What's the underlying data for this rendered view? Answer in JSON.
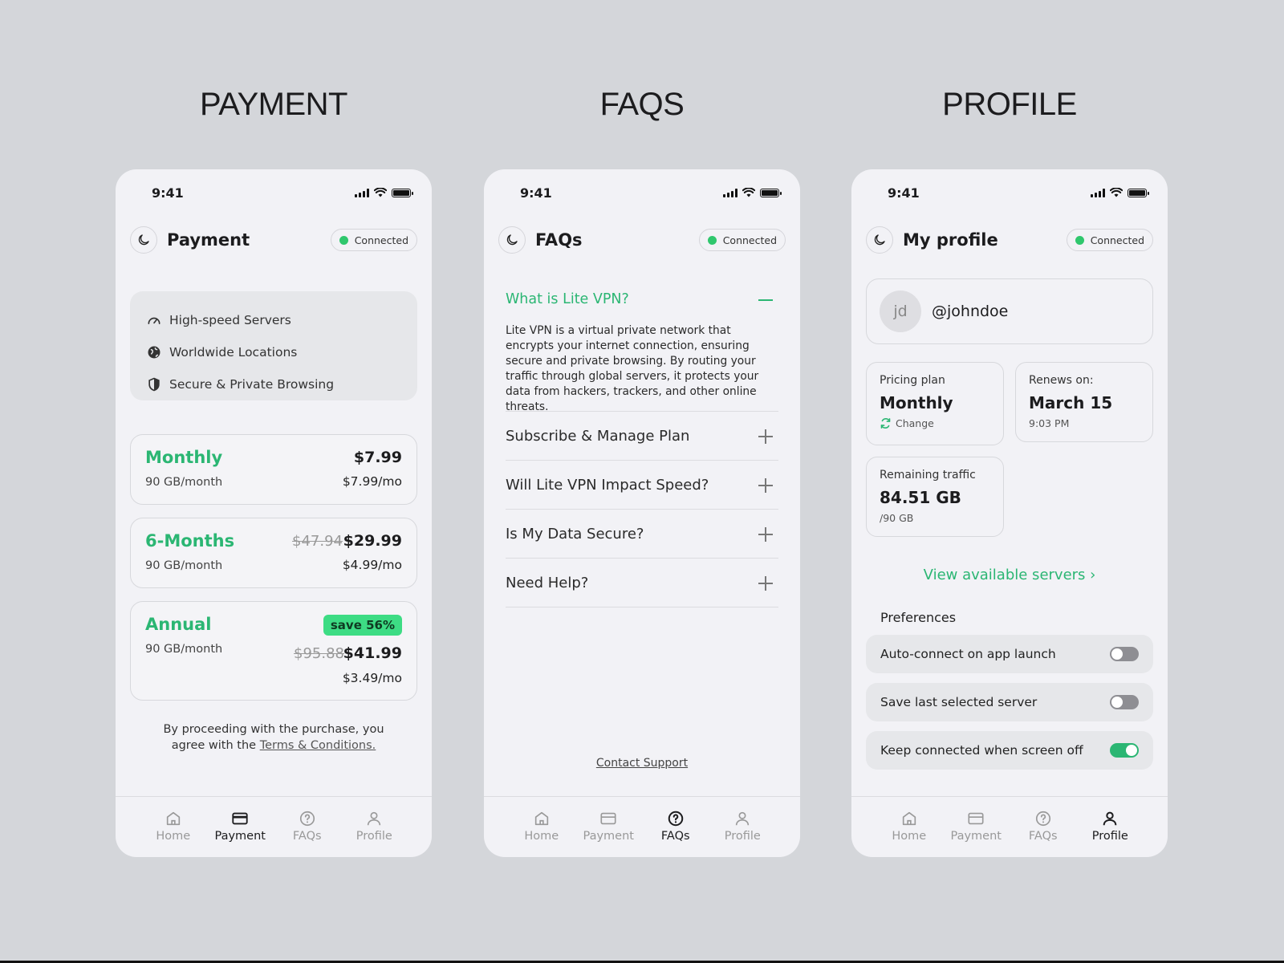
{
  "headings": {
    "payment": "PAYMENT",
    "faqs": "FAQS",
    "profile": "PROFILE"
  },
  "status": {
    "time": "9:41"
  },
  "connection_label": "Connected",
  "accent_color": "#2bb673",
  "payment": {
    "title": "Payment",
    "features": [
      {
        "icon": "speedometer-icon",
        "label": "High-speed Servers"
      },
      {
        "icon": "globe-icon",
        "label": "Worldwide Locations"
      },
      {
        "icon": "shield-icon",
        "label": "Secure & Private Browsing"
      }
    ],
    "plans": [
      {
        "name": "Monthly",
        "data": "90 GB/month",
        "price": "$7.99",
        "per_month": "$7.99/mo"
      },
      {
        "name": "6-Months",
        "data": "90 GB/month",
        "old_price": "$47.94",
        "price": "$29.99",
        "per_month": "$4.99/mo"
      },
      {
        "name": "Annual",
        "data": "90 GB/month",
        "badge": "save 56%",
        "old_price": "$95.88",
        "price": "$41.99",
        "per_month": "$3.49/mo"
      }
    ],
    "terms_prefix": "By proceeding with the purchase, you",
    "terms_middle": "agree with the ",
    "terms_link": "Terms & Conditions."
  },
  "faqs": {
    "title": "FAQs",
    "open_question": "What is Lite VPN?",
    "open_answer": "Lite VPN is a virtual private network that encrypts your internet connection, ensuring secure and private browsing. By routing your traffic through global servers, it protects your data from hackers, trackers, and other online threats.",
    "questions": [
      "Subscribe & Manage Plan",
      "Will Lite VPN Impact Speed?",
      "Is My Data Secure?",
      "Need Help?"
    ],
    "contact": "Contact Support"
  },
  "profile": {
    "title": "My profile",
    "avatar_initials": "jd",
    "username": "@johndoe",
    "pricing_label": "Pricing plan",
    "pricing_value": "Monthly",
    "change_label": "Change",
    "renews_label": "Renews on:",
    "renews_value": "March 15",
    "renews_time": "9:03 PM",
    "traffic_label": "Remaining traffic",
    "traffic_value": "84.51 GB",
    "traffic_total": "/90 GB",
    "view_servers": "View available servers ›",
    "preferences_title": "Preferences",
    "preferences": [
      {
        "label": "Auto-connect on app launch",
        "enabled": false
      },
      {
        "label": "Save last selected server",
        "enabled": false
      },
      {
        "label": "Keep connected when screen off",
        "enabled": true
      }
    ]
  },
  "tabs": [
    "Home",
    "Payment",
    "FAQs",
    "Profile"
  ]
}
